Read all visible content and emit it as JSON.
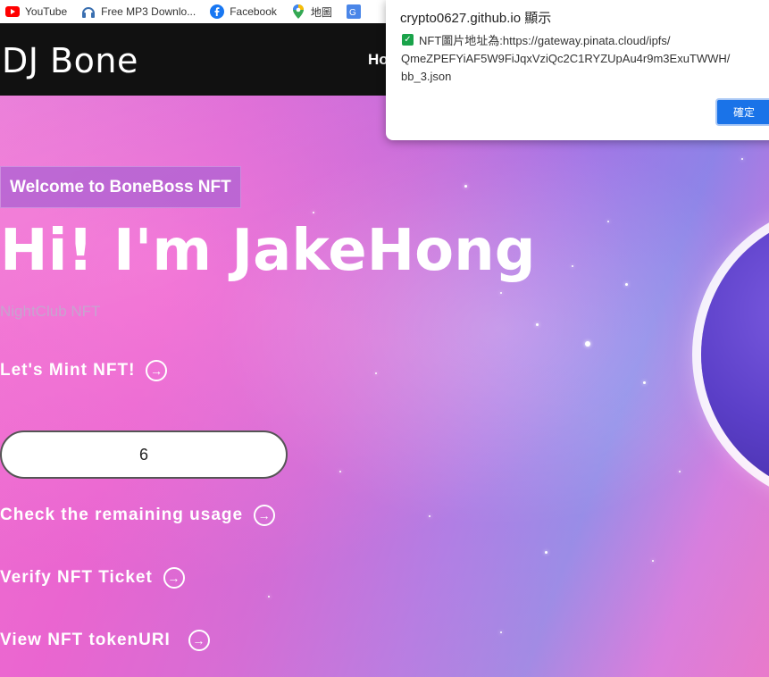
{
  "bookmarks": [
    {
      "label": "YouTube",
      "icon": "youtube-icon"
    },
    {
      "label": "Free MP3 Downlo...",
      "icon": "headphones-icon"
    },
    {
      "label": "Facebook",
      "icon": "facebook-icon"
    },
    {
      "label": "地圖",
      "icon": "maps-pin-icon"
    },
    {
      "label": "",
      "icon": "translate-icon"
    }
  ],
  "header": {
    "brand": "DJ Bone",
    "nav_partial": "Ho"
  },
  "hero": {
    "welcome": "Welcome to BoneBoss NFT",
    "headline": "Hi! I'm JakeHong",
    "subtitle": "NightClub NFT",
    "mint_label": "Let's Mint NFT!",
    "input_value": "6",
    "check_label": "Check the remaining usage",
    "verify_label": "Verify NFT Ticket",
    "view_label": "View NFT tokenURI",
    "arrow_glyph": "→"
  },
  "dialog": {
    "title": "crypto0627.github.io 顯示",
    "message_line1": "NFT圖片地址為:https://gateway.pinata.cloud/ipfs/",
    "message_line2": "QmeZPEFYiAF5W9FiJqxVziQc2C1RYZUpAu4r9m3ExuTWWH/",
    "message_line3": "bb_3.json",
    "ok_label": "確定",
    "check_icon": "check-box-icon"
  },
  "colors": {
    "header_bg": "#111111",
    "welcome_bg": "#b464d2",
    "subtitle": "#c7a3cf",
    "dialog_button": "#1a73e8",
    "youtube": "#ff0000",
    "facebook": "#1877f2"
  }
}
